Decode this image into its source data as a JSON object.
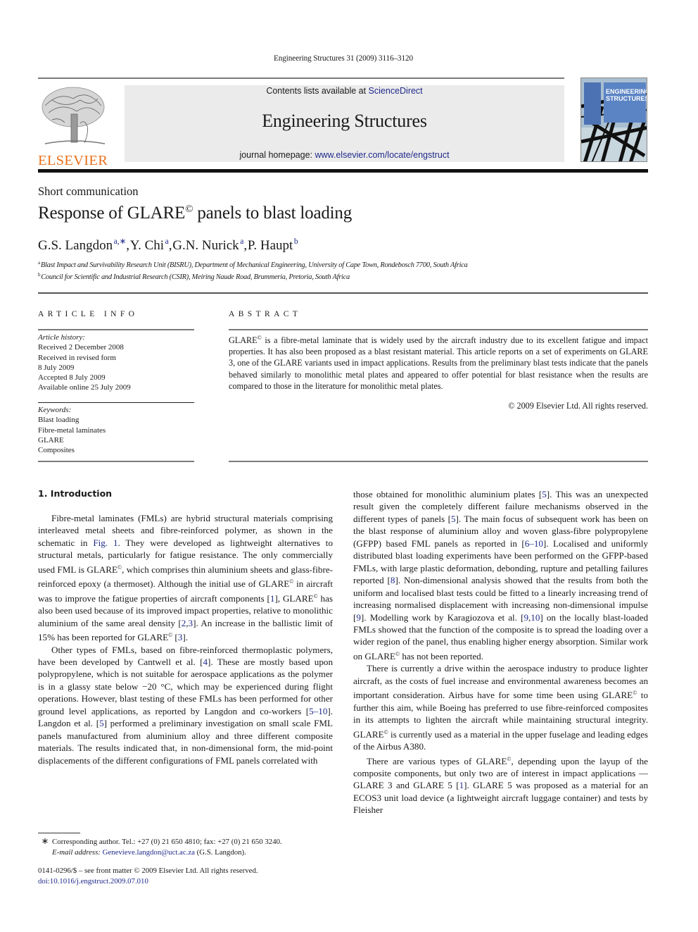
{
  "running_head": "Engineering Structures 31 (2009) 3116–3120",
  "banner": {
    "contents_prefix": "Contents lists available at ",
    "contents_link": "ScienceDirect",
    "journal_title": "Engineering Structures",
    "homepage_prefix": "journal homepage: ",
    "homepage_link": "www.elsevier.com/locate/engstruct"
  },
  "publisher_logo": {
    "wordmark": "ELSEVIER",
    "color": "#e9711c"
  },
  "cover": {
    "line1": "ENGINEERING",
    "line2": "STRUCTURES"
  },
  "article": {
    "type": "Short communication",
    "title_pre": "Response of GLARE",
    "title_sup": "©",
    "title_post": " panels to blast loading",
    "authors": [
      {
        "name": "G.S. Langdon",
        "sup": "a,∗",
        "sep": ", "
      },
      {
        "name": "Y. Chi",
        "sup": "a",
        "sep": ", "
      },
      {
        "name": "G.N. Nurick",
        "sup": "a",
        "sep": ", "
      },
      {
        "name": "P. Haupt",
        "sup": "b",
        "sep": ""
      }
    ],
    "affiliations": [
      {
        "mark": "a",
        "text": "Blast Impact and Survivability Research Unit (BISRU), Department of Mechanical Engineering, University of Cape Town, Rondebosch 7700, South Africa"
      },
      {
        "mark": "b",
        "text": "Council for Scientific and Industrial Research (CSIR), Meiring Naude Road, Brummeria, Pretoria, South Africa"
      }
    ]
  },
  "article_info": {
    "heading": "ARTICLE INFO",
    "history_label": "Article history:",
    "history": [
      "Received 2 December 2008",
      "Received in revised form",
      "8 July 2009",
      "Accepted 8 July 2009",
      "Available online 25 July 2009"
    ],
    "keywords_label": "Keywords:",
    "keywords": [
      "Blast loading",
      "Fibre-metal laminates",
      "GLARE",
      "Composites"
    ]
  },
  "abstract": {
    "heading": "ABSTRACT",
    "text_pre": "GLARE",
    "text_sup": "©",
    "text_post": " is a fibre-metal laminate that is widely used by the aircraft industry due to its excellent fatigue and impact properties. It has also been proposed as a blast resistant material. This article reports on a set of experiments on GLARE 3, one of the GLARE variants used in impact applications. Results from the preliminary blast tests indicate that the panels behaved similarly to monolithic metal plates and appeared to offer potential for blast resistance when the results are compared to those in the literature for monolithic metal plates.",
    "copyright": "© 2009 Elsevier Ltd. All rights reserved."
  },
  "section1": {
    "heading": "1.  Introduction",
    "paragraphs": [
      [
        {
          "t": "Fibre-metal laminates (FMLs) are hybrid structural materials comprising interleaved metal sheets and fibre-reinforced polymer, as shown in the schematic in "
        },
        {
          "link": "Fig. 1"
        },
        {
          "t": ". They were developed as lightweight alternatives to structural metals, particularly for fatigue resistance. The only commercially used FML is GLARE"
        },
        {
          "sup": "©"
        },
        {
          "t": ", which comprises thin aluminium sheets and glass-fibre-reinforced epoxy (a thermoset). Although the initial use of GLARE"
        },
        {
          "sup": "©"
        },
        {
          "t": " in aircraft was to improve the fatigue properties of aircraft components ["
        },
        {
          "link": "1"
        },
        {
          "t": "], GLARE"
        },
        {
          "sup": "©"
        },
        {
          "t": " has also been used because of its improved impact properties, relative to monolithic aluminium of the same areal density ["
        },
        {
          "link": "2"
        },
        {
          "t": ","
        },
        {
          "link": "3"
        },
        {
          "t": "]. An increase in the ballistic limit of 15% has been reported for GLARE"
        },
        {
          "sup": "©"
        },
        {
          "t": " ["
        },
        {
          "link": "3"
        },
        {
          "t": "]."
        }
      ],
      [
        {
          "t": "Other types of FMLs, based on fibre-reinforced thermoplastic polymers, have been developed by Cantwell et al. ["
        },
        {
          "link": "4"
        },
        {
          "t": "]. These are mostly based upon polypropylene, which is not suitable for aerospace applications as the polymer is in a glassy state below −20 °C, which may be experienced during flight operations. However, blast testing of these FMLs has been performed for other ground level applications, as reported by Langdon and co-workers ["
        },
        {
          "link": "5–10"
        },
        {
          "t": "]. Langdon et al. ["
        },
        {
          "link": "5"
        },
        {
          "t": "] performed a preliminary investigation on small scale FML panels manufactured from aluminium alloy and three different composite materials. The results indicated that, in non-dimensional form, the mid-point displacements of the different configurations of FML panels correlated with"
        }
      ]
    ],
    "right_paragraphs": [
      [
        {
          "t": "those obtained for monolithic aluminium plates ["
        },
        {
          "link": "5"
        },
        {
          "t": "]. This was an unexpected result given the completely different failure mechanisms observed in the different types of panels ["
        },
        {
          "link": "5"
        },
        {
          "t": "]. The main focus of subsequent work has been on the blast response of aluminium alloy and woven glass-fibre polypropylene (GFPP) based FML panels as reported in ["
        },
        {
          "link": "6–10"
        },
        {
          "t": "]. Localised and uniformly distributed blast loading experiments have been performed on the GFPP-based FMLs, with large plastic deformation, debonding, rupture and petalling failures reported ["
        },
        {
          "link": "8"
        },
        {
          "t": "]. Non-dimensional analysis showed that the results from both the uniform and localised blast tests could be fitted to a linearly increasing trend of increasing normalised displacement with increasing non-dimensional impulse ["
        },
        {
          "link": "9"
        },
        {
          "t": "]. Modelling work by Karagiozova et al. ["
        },
        {
          "link": "9"
        },
        {
          "t": ","
        },
        {
          "link": "10"
        },
        {
          "t": "] on the locally blast-loaded FMLs showed that the function of the composite is to spread the loading over a wider region of the panel, thus enabling higher energy absorption. Similar work on GLARE"
        },
        {
          "sup": "©"
        },
        {
          "t": " has not been reported."
        }
      ],
      [
        {
          "t": "There is currently a drive within the aerospace industry to produce lighter aircraft, as the costs of fuel increase and environmental awareness becomes an important consideration. Airbus have for some time been using GLARE"
        },
        {
          "sup": "©"
        },
        {
          "t": " to further this aim, while Boeing has preferred to use fibre-reinforced composites in its attempts to lighten the aircraft while maintaining structural integrity. GLARE"
        },
        {
          "sup": "©"
        },
        {
          "t": " is currently used as a material in the upper fuselage and leading edges of the Airbus A380."
        }
      ],
      [
        {
          "t": "There are various types of GLARE"
        },
        {
          "sup": "©"
        },
        {
          "t": ", depending upon the layup of the composite components, but only two are of interest in impact applications — GLARE 3 and GLARE 5 ["
        },
        {
          "link": "1"
        },
        {
          "t": "]. GLARE 5 was proposed as a material for an ECOS3 unit load device (a lightweight aircraft luggage container) and tests by Fleisher"
        }
      ]
    ]
  },
  "footnote": {
    "star": "∗",
    "corresponding": "Corresponding author. Tel.: +27 (0) 21 650 4810; fax: +27 (0) 21 650 3240.",
    "email_label": "E-mail address:",
    "email": "Genevieve.langdon@uct.ac.za",
    "email_suffix": " (G.S. Langdon)."
  },
  "front_matter": {
    "issn_line": "0141-0296/$ – see front matter © 2009 Elsevier Ltd. All rights reserved.",
    "doi": "doi:10.1016/j.engstruct.2009.07.010"
  }
}
